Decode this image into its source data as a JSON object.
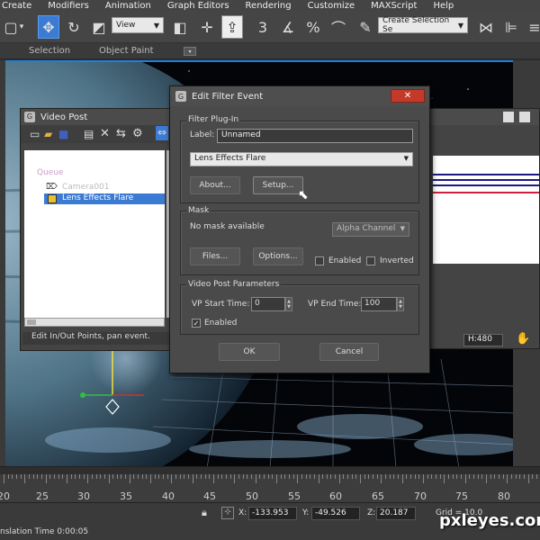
{
  "menubar": {
    "items": [
      "Create",
      "Modifiers",
      "Animation",
      "Graph Editors",
      "Rendering",
      "Customize",
      "MAXScript",
      "Help"
    ]
  },
  "toolbar": {
    "view_select": "View",
    "selection_set": "Create Selection Se",
    "icons": [
      "undo-icon",
      "select-icon",
      "select-move-icon",
      "rotate-icon",
      "scale-icon",
      "link-icon",
      "snap-icon",
      "angle-snap-icon",
      "percent-snap-icon",
      "spinner-snap-icon",
      "mirror-icon",
      "align-icon"
    ]
  },
  "ribbon": {
    "selection": "Selection",
    "object_paint": "Object Paint"
  },
  "video_post": {
    "title": "Video Post",
    "tree": {
      "queue": "Queue",
      "camera": "Camera001",
      "lens": "Lens Effects Flare"
    },
    "status": "Edit In/Out Points, pan event."
  },
  "track_view": {
    "hval": "H:480"
  },
  "dialog": {
    "title": "Edit Filter Event",
    "filter_group": "Filter Plug-In",
    "label_caption": "Label:",
    "label_value": "Unnamed",
    "plugin_selected": "Lens Effects Flare",
    "about_button": "About...",
    "setup_button": "Setup...",
    "mask_group": "Mask",
    "no_mask": "No mask available",
    "mask_channel": "Alpha Channel",
    "files_button": "Files...",
    "options_button": "Options...",
    "enabled_mask": "Enabled",
    "inverted": "Inverted",
    "vp_group": "Video Post Parameters",
    "vp_start_label": "VP Start Time:",
    "vp_start_value": "0",
    "vp_end_label": "VP End Time:",
    "vp_end_value": "100",
    "enabled": "Enabled",
    "ok_button": "OK",
    "cancel_button": "Cancel"
  },
  "timeline": {
    "labels": [
      "20",
      "25",
      "30",
      "35",
      "40",
      "45",
      "50",
      "55",
      "60",
      "65",
      "70",
      "75",
      "80",
      "85",
      "90",
      "95"
    ]
  },
  "status": {
    "x_label": "X:",
    "x_value": "-133.953",
    "y_label": "Y:",
    "y_value": "-49.526",
    "z_label": "Z:",
    "z_value": "20.187",
    "grid": "Grid = 10.0",
    "left_text": "nslation Time  0:00:05"
  },
  "watermark": "pxleyes.com",
  "colors": {
    "accent": "#3b7bd4",
    "viewport_border": "#1f7fe0",
    "selection_highlight": "#3b7bd4"
  }
}
